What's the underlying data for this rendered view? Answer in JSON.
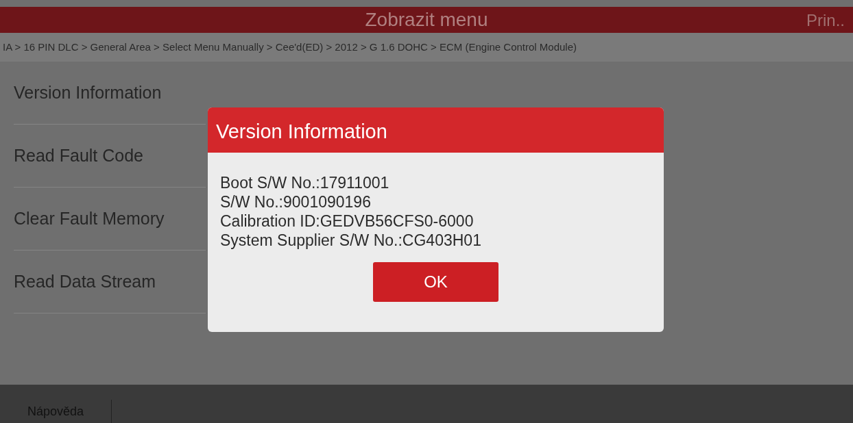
{
  "header": {
    "title": "Zobrazit menu",
    "action": "Prin.."
  },
  "breadcrumb": "IA > 16 PIN DLC > General Area > Select Menu Manually > Cee'd(ED) > 2012 > G 1.6 DOHC > ECM (Engine Control Module)",
  "menu_items": [
    {
      "label": "Version Information"
    },
    {
      "label": "Read Fault Code"
    },
    {
      "label": "Clear Fault Memory"
    },
    {
      "label": "Read Data Stream"
    }
  ],
  "dialog": {
    "title": "Version Information",
    "lines": [
      "Boot S/W No.:17911001",
      "S/W No.:9001090196",
      "Calibration ID:GEDVB56CFS0-6000",
      "System Supplier S/W No.:CG403H01"
    ],
    "button": "OK"
  },
  "footer": {
    "buttons": [
      "Nápověda"
    ]
  }
}
